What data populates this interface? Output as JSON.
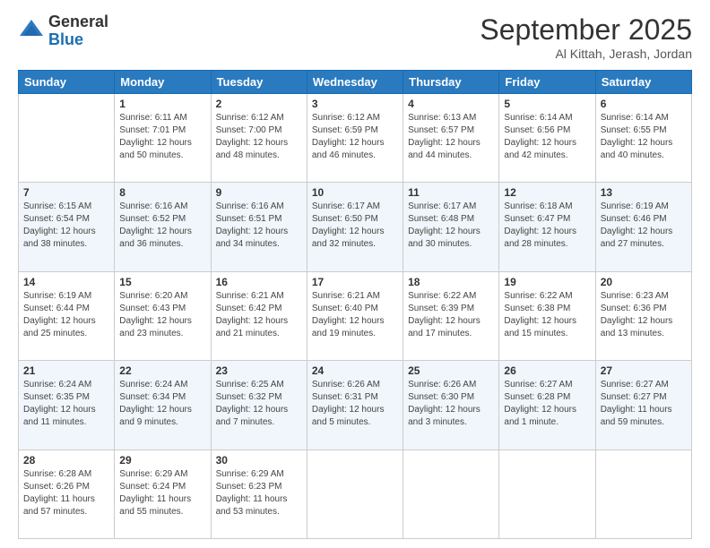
{
  "header": {
    "logo": {
      "line1": "General",
      "line2": "Blue"
    },
    "title": "September 2025",
    "location": "Al Kittah, Jerash, Jordan"
  },
  "days": [
    "Sunday",
    "Monday",
    "Tuesday",
    "Wednesday",
    "Thursday",
    "Friday",
    "Saturday"
  ],
  "weeks": [
    [
      {
        "day": "",
        "info": ""
      },
      {
        "day": "1",
        "info": "Sunrise: 6:11 AM\nSunset: 7:01 PM\nDaylight: 12 hours\nand 50 minutes."
      },
      {
        "day": "2",
        "info": "Sunrise: 6:12 AM\nSunset: 7:00 PM\nDaylight: 12 hours\nand 48 minutes."
      },
      {
        "day": "3",
        "info": "Sunrise: 6:12 AM\nSunset: 6:59 PM\nDaylight: 12 hours\nand 46 minutes."
      },
      {
        "day": "4",
        "info": "Sunrise: 6:13 AM\nSunset: 6:57 PM\nDaylight: 12 hours\nand 44 minutes."
      },
      {
        "day": "5",
        "info": "Sunrise: 6:14 AM\nSunset: 6:56 PM\nDaylight: 12 hours\nand 42 minutes."
      },
      {
        "day": "6",
        "info": "Sunrise: 6:14 AM\nSunset: 6:55 PM\nDaylight: 12 hours\nand 40 minutes."
      }
    ],
    [
      {
        "day": "7",
        "info": "Sunrise: 6:15 AM\nSunset: 6:54 PM\nDaylight: 12 hours\nand 38 minutes."
      },
      {
        "day": "8",
        "info": "Sunrise: 6:16 AM\nSunset: 6:52 PM\nDaylight: 12 hours\nand 36 minutes."
      },
      {
        "day": "9",
        "info": "Sunrise: 6:16 AM\nSunset: 6:51 PM\nDaylight: 12 hours\nand 34 minutes."
      },
      {
        "day": "10",
        "info": "Sunrise: 6:17 AM\nSunset: 6:50 PM\nDaylight: 12 hours\nand 32 minutes."
      },
      {
        "day": "11",
        "info": "Sunrise: 6:17 AM\nSunset: 6:48 PM\nDaylight: 12 hours\nand 30 minutes."
      },
      {
        "day": "12",
        "info": "Sunrise: 6:18 AM\nSunset: 6:47 PM\nDaylight: 12 hours\nand 28 minutes."
      },
      {
        "day": "13",
        "info": "Sunrise: 6:19 AM\nSunset: 6:46 PM\nDaylight: 12 hours\nand 27 minutes."
      }
    ],
    [
      {
        "day": "14",
        "info": "Sunrise: 6:19 AM\nSunset: 6:44 PM\nDaylight: 12 hours\nand 25 minutes."
      },
      {
        "day": "15",
        "info": "Sunrise: 6:20 AM\nSunset: 6:43 PM\nDaylight: 12 hours\nand 23 minutes."
      },
      {
        "day": "16",
        "info": "Sunrise: 6:21 AM\nSunset: 6:42 PM\nDaylight: 12 hours\nand 21 minutes."
      },
      {
        "day": "17",
        "info": "Sunrise: 6:21 AM\nSunset: 6:40 PM\nDaylight: 12 hours\nand 19 minutes."
      },
      {
        "day": "18",
        "info": "Sunrise: 6:22 AM\nSunset: 6:39 PM\nDaylight: 12 hours\nand 17 minutes."
      },
      {
        "day": "19",
        "info": "Sunrise: 6:22 AM\nSunset: 6:38 PM\nDaylight: 12 hours\nand 15 minutes."
      },
      {
        "day": "20",
        "info": "Sunrise: 6:23 AM\nSunset: 6:36 PM\nDaylight: 12 hours\nand 13 minutes."
      }
    ],
    [
      {
        "day": "21",
        "info": "Sunrise: 6:24 AM\nSunset: 6:35 PM\nDaylight: 12 hours\nand 11 minutes."
      },
      {
        "day": "22",
        "info": "Sunrise: 6:24 AM\nSunset: 6:34 PM\nDaylight: 12 hours\nand 9 minutes."
      },
      {
        "day": "23",
        "info": "Sunrise: 6:25 AM\nSunset: 6:32 PM\nDaylight: 12 hours\nand 7 minutes."
      },
      {
        "day": "24",
        "info": "Sunrise: 6:26 AM\nSunset: 6:31 PM\nDaylight: 12 hours\nand 5 minutes."
      },
      {
        "day": "25",
        "info": "Sunrise: 6:26 AM\nSunset: 6:30 PM\nDaylight: 12 hours\nand 3 minutes."
      },
      {
        "day": "26",
        "info": "Sunrise: 6:27 AM\nSunset: 6:28 PM\nDaylight: 12 hours\nand 1 minute."
      },
      {
        "day": "27",
        "info": "Sunrise: 6:27 AM\nSunset: 6:27 PM\nDaylight: 11 hours\nand 59 minutes."
      }
    ],
    [
      {
        "day": "28",
        "info": "Sunrise: 6:28 AM\nSunset: 6:26 PM\nDaylight: 11 hours\nand 57 minutes."
      },
      {
        "day": "29",
        "info": "Sunrise: 6:29 AM\nSunset: 6:24 PM\nDaylight: 11 hours\nand 55 minutes."
      },
      {
        "day": "30",
        "info": "Sunrise: 6:29 AM\nSunset: 6:23 PM\nDaylight: 11 hours\nand 53 minutes."
      },
      {
        "day": "",
        "info": ""
      },
      {
        "day": "",
        "info": ""
      },
      {
        "day": "",
        "info": ""
      },
      {
        "day": "",
        "info": ""
      }
    ]
  ]
}
